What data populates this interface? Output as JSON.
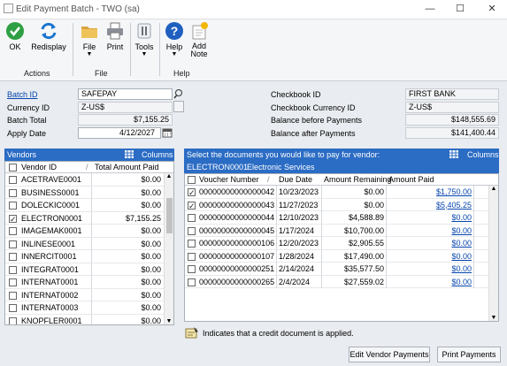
{
  "window": {
    "title": "Edit Payment Batch  -  TWO (sa)"
  },
  "ribbon": {
    "ok": "OK",
    "redisplay": "Redisplay",
    "group_actions": "Actions",
    "file": "File",
    "print": "Print",
    "group_file": "File",
    "tools": "Tools",
    "help": "Help",
    "add_note": "Add\nNote",
    "group_help": "Help"
  },
  "batch": {
    "batch_id_label": "Batch ID",
    "batch_id": "SAFEPAY",
    "currency_id_label": "Currency ID",
    "currency_id": "Z-US$",
    "batch_total_label": "Batch Total",
    "batch_total": "$7,155.25",
    "apply_date_label": "Apply Date",
    "apply_date": "4/12/2027"
  },
  "checkbook": {
    "checkbook_id_label": "Checkbook ID",
    "checkbook_id": "FIRST BANK",
    "currency_label": "Checkbook Currency ID",
    "currency": "Z-US$",
    "before_label": "Balance before Payments",
    "before": "$148,555.69",
    "after_label": "Balance after Payments",
    "after": "$141,400.44"
  },
  "vendors": {
    "title": "Vendors",
    "columns_label": "Columns",
    "col_id": "Vendor ID",
    "col_total": "Total Amount Paid",
    "rows": [
      {
        "id": "ACETRAVE0001",
        "amt": "$0.00",
        "checked": false
      },
      {
        "id": "BUSINESS0001",
        "amt": "$0.00",
        "checked": false
      },
      {
        "id": "DOLECKIC0001",
        "amt": "$0.00",
        "checked": false
      },
      {
        "id": "ELECTRON0001",
        "amt": "$7,155.25",
        "checked": true
      },
      {
        "id": "IMAGEMAK0001",
        "amt": "$0.00",
        "checked": false
      },
      {
        "id": "INLINESE0001",
        "amt": "$0.00",
        "checked": false
      },
      {
        "id": "INNERCIT0001",
        "amt": "$0.00",
        "checked": false
      },
      {
        "id": "INTEGRAT0001",
        "amt": "$0.00",
        "checked": false
      },
      {
        "id": "INTERNAT0001",
        "amt": "$0.00",
        "checked": false
      },
      {
        "id": "INTERNAT0002",
        "amt": "$0.00",
        "checked": false
      },
      {
        "id": "INTERNAT0003",
        "amt": "$0.00",
        "checked": false
      },
      {
        "id": "KNOPFLER0001",
        "amt": "$0.00",
        "checked": false
      }
    ]
  },
  "documents": {
    "prompt": "Select the documents you would like to pay for vendor:",
    "vendor_id": "ELECTRON0001",
    "vendor_name": "Electronic Services",
    "columns_label": "Columns",
    "col_voucher": "Voucher Number",
    "col_due": "Due Date",
    "col_remaining": "Amount Remaining",
    "col_paid": "Amount Paid",
    "rows": [
      {
        "voucher": "00000000000000042",
        "due": "10/23/2023",
        "remaining": "$0.00",
        "paid": "$1,750.00",
        "checked": true
      },
      {
        "voucher": "00000000000000043",
        "due": "11/27/2023",
        "remaining": "$0.00",
        "paid": "$5,405.25",
        "checked": true
      },
      {
        "voucher": "00000000000000044",
        "due": "12/10/2023",
        "remaining": "$4,588.89",
        "paid": "$0.00",
        "checked": false
      },
      {
        "voucher": "00000000000000045",
        "due": "1/17/2024",
        "remaining": "$10,700.00",
        "paid": "$0.00",
        "checked": false
      },
      {
        "voucher": "00000000000000106",
        "due": "12/20/2023",
        "remaining": "$2,905.55",
        "paid": "$0.00",
        "checked": false
      },
      {
        "voucher": "00000000000000107",
        "due": "1/28/2024",
        "remaining": "$17,490.00",
        "paid": "$0.00",
        "checked": false
      },
      {
        "voucher": "00000000000000251",
        "due": "2/14/2024",
        "remaining": "$35,577.50",
        "paid": "$0.00",
        "checked": false
      },
      {
        "voucher": "00000000000000265",
        "due": "2/4/2024",
        "remaining": "$27,559.02",
        "paid": "$0.00",
        "checked": false
      }
    ]
  },
  "footer": {
    "credit_note": "Indicates that a credit document is applied.",
    "edit_vendor_btn": "Edit Vendor Payments",
    "print_payments_btn": "Print Payments"
  }
}
